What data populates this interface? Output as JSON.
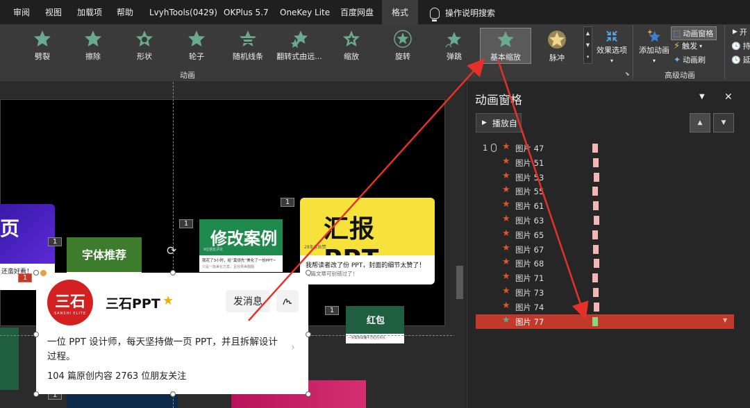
{
  "menubar": {
    "tabs": [
      "审阅",
      "视图",
      "加载项",
      "帮助",
      "LvyhTools(0429)",
      "OKPlus 5.7",
      "OneKey Lite",
      "百度网盘",
      "格式"
    ],
    "active_tab": "格式",
    "search_label": "操作说明搜索"
  },
  "ribbon": {
    "animations": [
      "劈裂",
      "擦除",
      "形状",
      "轮子",
      "随机线条",
      "翻转式由远...",
      "缩放",
      "旋转",
      "弹跳",
      "基本缩放",
      "脉冲"
    ],
    "selected_animation": "基本缩放",
    "effect_options": "效果选项",
    "group_animation": "动画",
    "add_animation": "添加动画",
    "animation_pane": "动画窗格",
    "trigger": "触发",
    "animation_painter": "动画刷",
    "group_advanced": "高级动画",
    "timing_labels": [
      "开",
      "持",
      "延"
    ],
    "colors": {
      "star_green": "#6aa88f",
      "star_blue": "#3a7fd0",
      "pulse_gold": "#e8c26a",
      "accent_red": "#c0392b"
    }
  },
  "slide": {
    "thumbnails": {
      "font_rec": "字体推荐",
      "case_title": "修改案例",
      "case_sub": "9位朋友评论",
      "case_line": "我花了3小时，给“莫烦先”美化了一份PPT~",
      "case_line2": "只是一篇美化方案，且效果美翻翻",
      "report_title": "汇报 PPT",
      "report_tag": "28条发贴赞",
      "report_line1": "我帮读者改了份 PPT，封面的细节太赞了！",
      "report_line2": "这篇文章可别错过了！",
      "left_partial": "页",
      "left_line": "还蛮好看！",
      "red_pack": "红包",
      "red_line": "一文帮你读懂千万红包大礼"
    },
    "animation_tags": [
      "1",
      "1",
      "1",
      "1",
      "1",
      "1",
      "1",
      "1",
      "1",
      "1"
    ]
  },
  "popup": {
    "logo_text": "三石",
    "logo_sub": "SANSHI ELITE",
    "name": "三石PPT",
    "message_button": "发消息",
    "description": "一位 PPT 设计师，每天坚持做一页 PPT，并且拆解设计过程。",
    "stats": "104 篇原创内容  2763 位朋友关注"
  },
  "pane": {
    "title": "动画窗格",
    "play_from": "播放自",
    "items": [
      {
        "num": "1",
        "name": "图片 47",
        "bar": 0.45,
        "first": true
      },
      {
        "name": "图片 51",
        "bar": 0.45
      },
      {
        "name": "图片 53",
        "bar": 0.45
      },
      {
        "name": "图片 55",
        "bar": 0.45
      },
      {
        "name": "图片 61",
        "bar": 0.45
      },
      {
        "name": "图片 63",
        "bar": 0.45
      },
      {
        "name": "图片 65",
        "bar": 0.45
      },
      {
        "name": "图片 67",
        "bar": 0.45
      },
      {
        "name": "图片 68",
        "bar": 0.45
      },
      {
        "name": "图片 71",
        "bar": 0.45
      },
      {
        "name": "图片 73",
        "bar": 0.45
      },
      {
        "name": "图片 74",
        "bar": 0.45
      },
      {
        "name": "图片 77",
        "bar": 0.45,
        "selected": true
      }
    ]
  }
}
